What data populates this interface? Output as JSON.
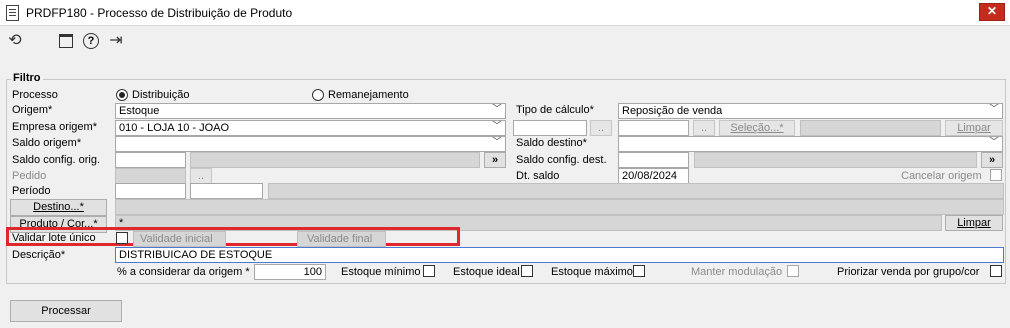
{
  "window": {
    "title": "PRDFP180 - Processo de Distribuição de Produto",
    "close_glyph": "✕"
  },
  "icons": {
    "app": "document-icon",
    "refresh": "refresh-icon",
    "calendar": "calendar-icon",
    "help": "help-icon",
    "exit": "exit-icon",
    "ellipsis_glyph": "..",
    "nav_glyph": "»"
  },
  "group": {
    "title": "Filtro"
  },
  "processo": {
    "label": "Processo",
    "opt1": "Distribuição",
    "opt2": "Remanejamento",
    "selected": "Distribuição"
  },
  "origem": {
    "label": "Origem*",
    "value": "Estoque"
  },
  "empresa_origem": {
    "label": "Empresa origem*",
    "value": "010 - LOJA 10 - JOAO"
  },
  "saldo_origem": {
    "label": "Saldo origem*",
    "value": ""
  },
  "saldo_config_orig": {
    "label": "Saldo config. orig.",
    "value": ""
  },
  "pedido": {
    "label": "Pedido"
  },
  "periodo": {
    "label": "Período"
  },
  "destino_btn": {
    "label": "Destino...*"
  },
  "produto_btn": {
    "label": "Produto / Cor...*",
    "value": "*"
  },
  "validar_lote": {
    "label": "Validar lote único",
    "validade_inicial": "Validade inicial",
    "validade_final": "Validade final"
  },
  "descricao": {
    "label": "Descrição*",
    "value": "DISTRIBUICAO DE ESTOQUE"
  },
  "percent": {
    "label": "% a considerar da origem *",
    "value": "100"
  },
  "estoque_minimo": "Estoque mínimo",
  "estoque_ideal": "Estoque ideal",
  "estoque_maximo": "Estoque máximo",
  "manter_modulacao": "Manter modulação",
  "priorizar": "Priorizar venda por grupo/cor",
  "tipo_calculo": {
    "label": "Tipo de cálculo*",
    "value": "Reposição de venda"
  },
  "selecao_btn": "Seleção...*",
  "limpar": "Limpar",
  "saldo_destino": {
    "label": "Saldo destino*"
  },
  "saldo_config_dest": {
    "label": "Saldo config. dest."
  },
  "dt_saldo": {
    "label": "Dt. saldo",
    "value": "20/08/2024"
  },
  "cancelar_origem": "Cancelar origem",
  "processar": "Processar",
  "colors": {
    "highlight": "#e0282c",
    "close": "#c42b1c"
  }
}
